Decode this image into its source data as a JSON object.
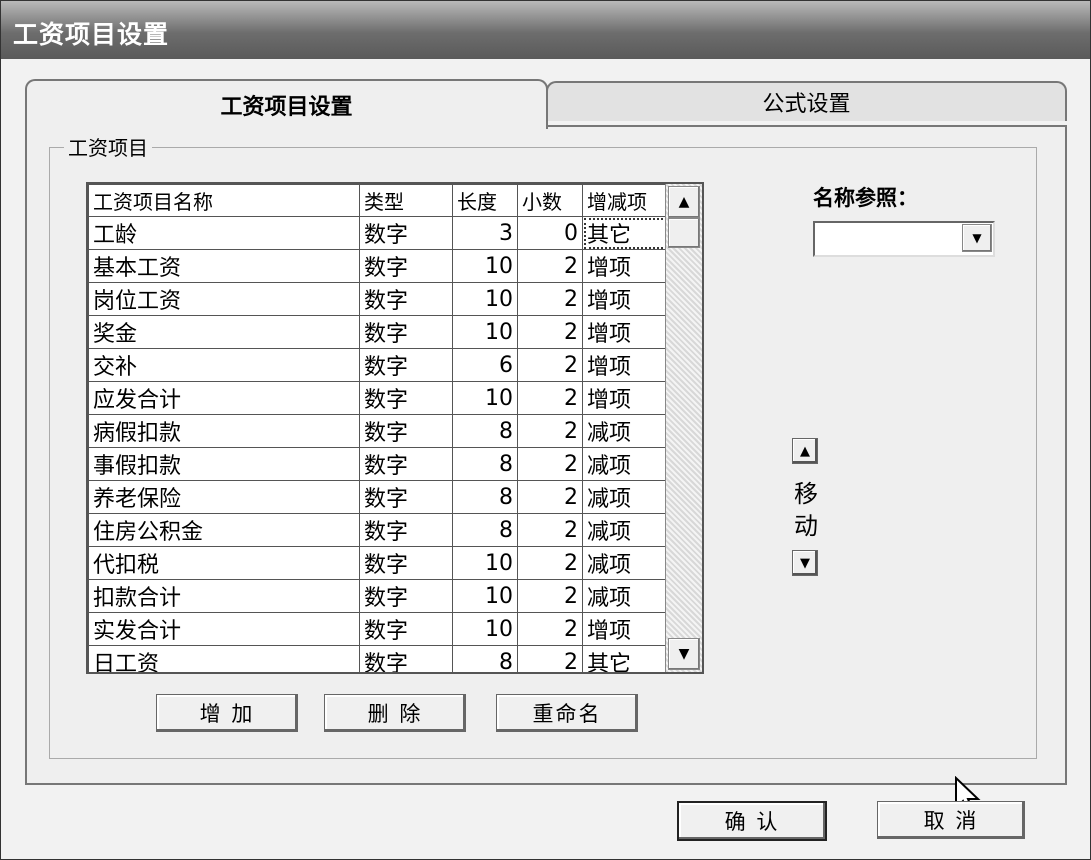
{
  "window": {
    "title": "工资项目设置"
  },
  "tabs": [
    {
      "label": "工资项目设置",
      "active": true
    },
    {
      "label": "公式设置",
      "active": false
    }
  ],
  "group": {
    "label": "工资项目"
  },
  "grid": {
    "columns": [
      "工资项目名称",
      "类型",
      "长度",
      "小数",
      "增减项"
    ],
    "rows": [
      [
        "工龄",
        "数字",
        "3",
        "0",
        "其它"
      ],
      [
        "基本工资",
        "数字",
        "10",
        "2",
        "增项"
      ],
      [
        "岗位工资",
        "数字",
        "10",
        "2",
        "增项"
      ],
      [
        "奖金",
        "数字",
        "10",
        "2",
        "增项"
      ],
      [
        "交补",
        "数字",
        "6",
        "2",
        "增项"
      ],
      [
        "应发合计",
        "数字",
        "10",
        "2",
        "增项"
      ],
      [
        "病假扣款",
        "数字",
        "8",
        "2",
        "减项"
      ],
      [
        "事假扣款",
        "数字",
        "8",
        "2",
        "减项"
      ],
      [
        "养老保险",
        "数字",
        "8",
        "2",
        "减项"
      ],
      [
        "住房公积金",
        "数字",
        "8",
        "2",
        "减项"
      ],
      [
        "代扣税",
        "数字",
        "10",
        "2",
        "减项"
      ],
      [
        "扣款合计",
        "数字",
        "10",
        "2",
        "减项"
      ],
      [
        "实发合计",
        "数字",
        "10",
        "2",
        "增项"
      ],
      [
        "日工资",
        "数字",
        "8",
        "2",
        "其它"
      ]
    ]
  },
  "actions": {
    "add": "增 加",
    "delete": "删 除",
    "rename": "重命名"
  },
  "move": {
    "label": "移动",
    "up_icon": "triangle-up",
    "down_icon": "triangle-down"
  },
  "reference": {
    "label": "名称参照：",
    "value": ""
  },
  "footer": {
    "ok": "确 认",
    "cancel": "取 消"
  }
}
